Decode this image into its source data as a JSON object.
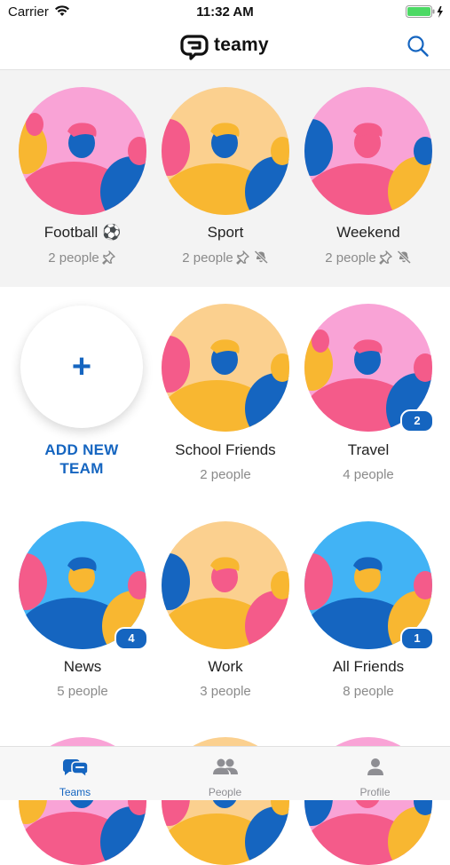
{
  "status_bar": {
    "carrier": "Carrier",
    "time": "11:32 AM"
  },
  "app": {
    "title": "teamy"
  },
  "colors": {
    "accent": "#1565c0",
    "pink": "#f45b8a",
    "orange": "#f8b731",
    "blue": "#1565c0",
    "sky": "#41b3f5",
    "peach": "#fbd08f",
    "lightpink": "#f9a3d6"
  },
  "pinned_teams": [
    {
      "name": "Football",
      "emoji": "⚽",
      "members": "2 people",
      "pinned": true,
      "muted": false
    },
    {
      "name": "Sport",
      "members": "2 people",
      "pinned": true,
      "muted": true
    },
    {
      "name": "Weekend",
      "members": "2 people",
      "pinned": true,
      "muted": true
    }
  ],
  "add_team": {
    "label_line1": "ADD NEW",
    "label_line2": "TEAM",
    "icon": "plus-icon"
  },
  "teams": [
    {
      "name": "School Friends",
      "members": "2 people",
      "badge": ""
    },
    {
      "name": "Travel",
      "members": "4 people",
      "badge": "2"
    },
    {
      "name": "News",
      "members": "5 people",
      "badge": "4"
    },
    {
      "name": "Work",
      "members": "3 people",
      "badge": ""
    },
    {
      "name": "All Friends",
      "members": "8 people",
      "badge": "1"
    }
  ],
  "tab_bar": [
    {
      "label": "Teams",
      "icon": "teams-chat-icon",
      "active": true
    },
    {
      "label": "People",
      "icon": "people-icon",
      "active": false
    },
    {
      "label": "Profile",
      "icon": "profile-icon",
      "active": false
    }
  ]
}
